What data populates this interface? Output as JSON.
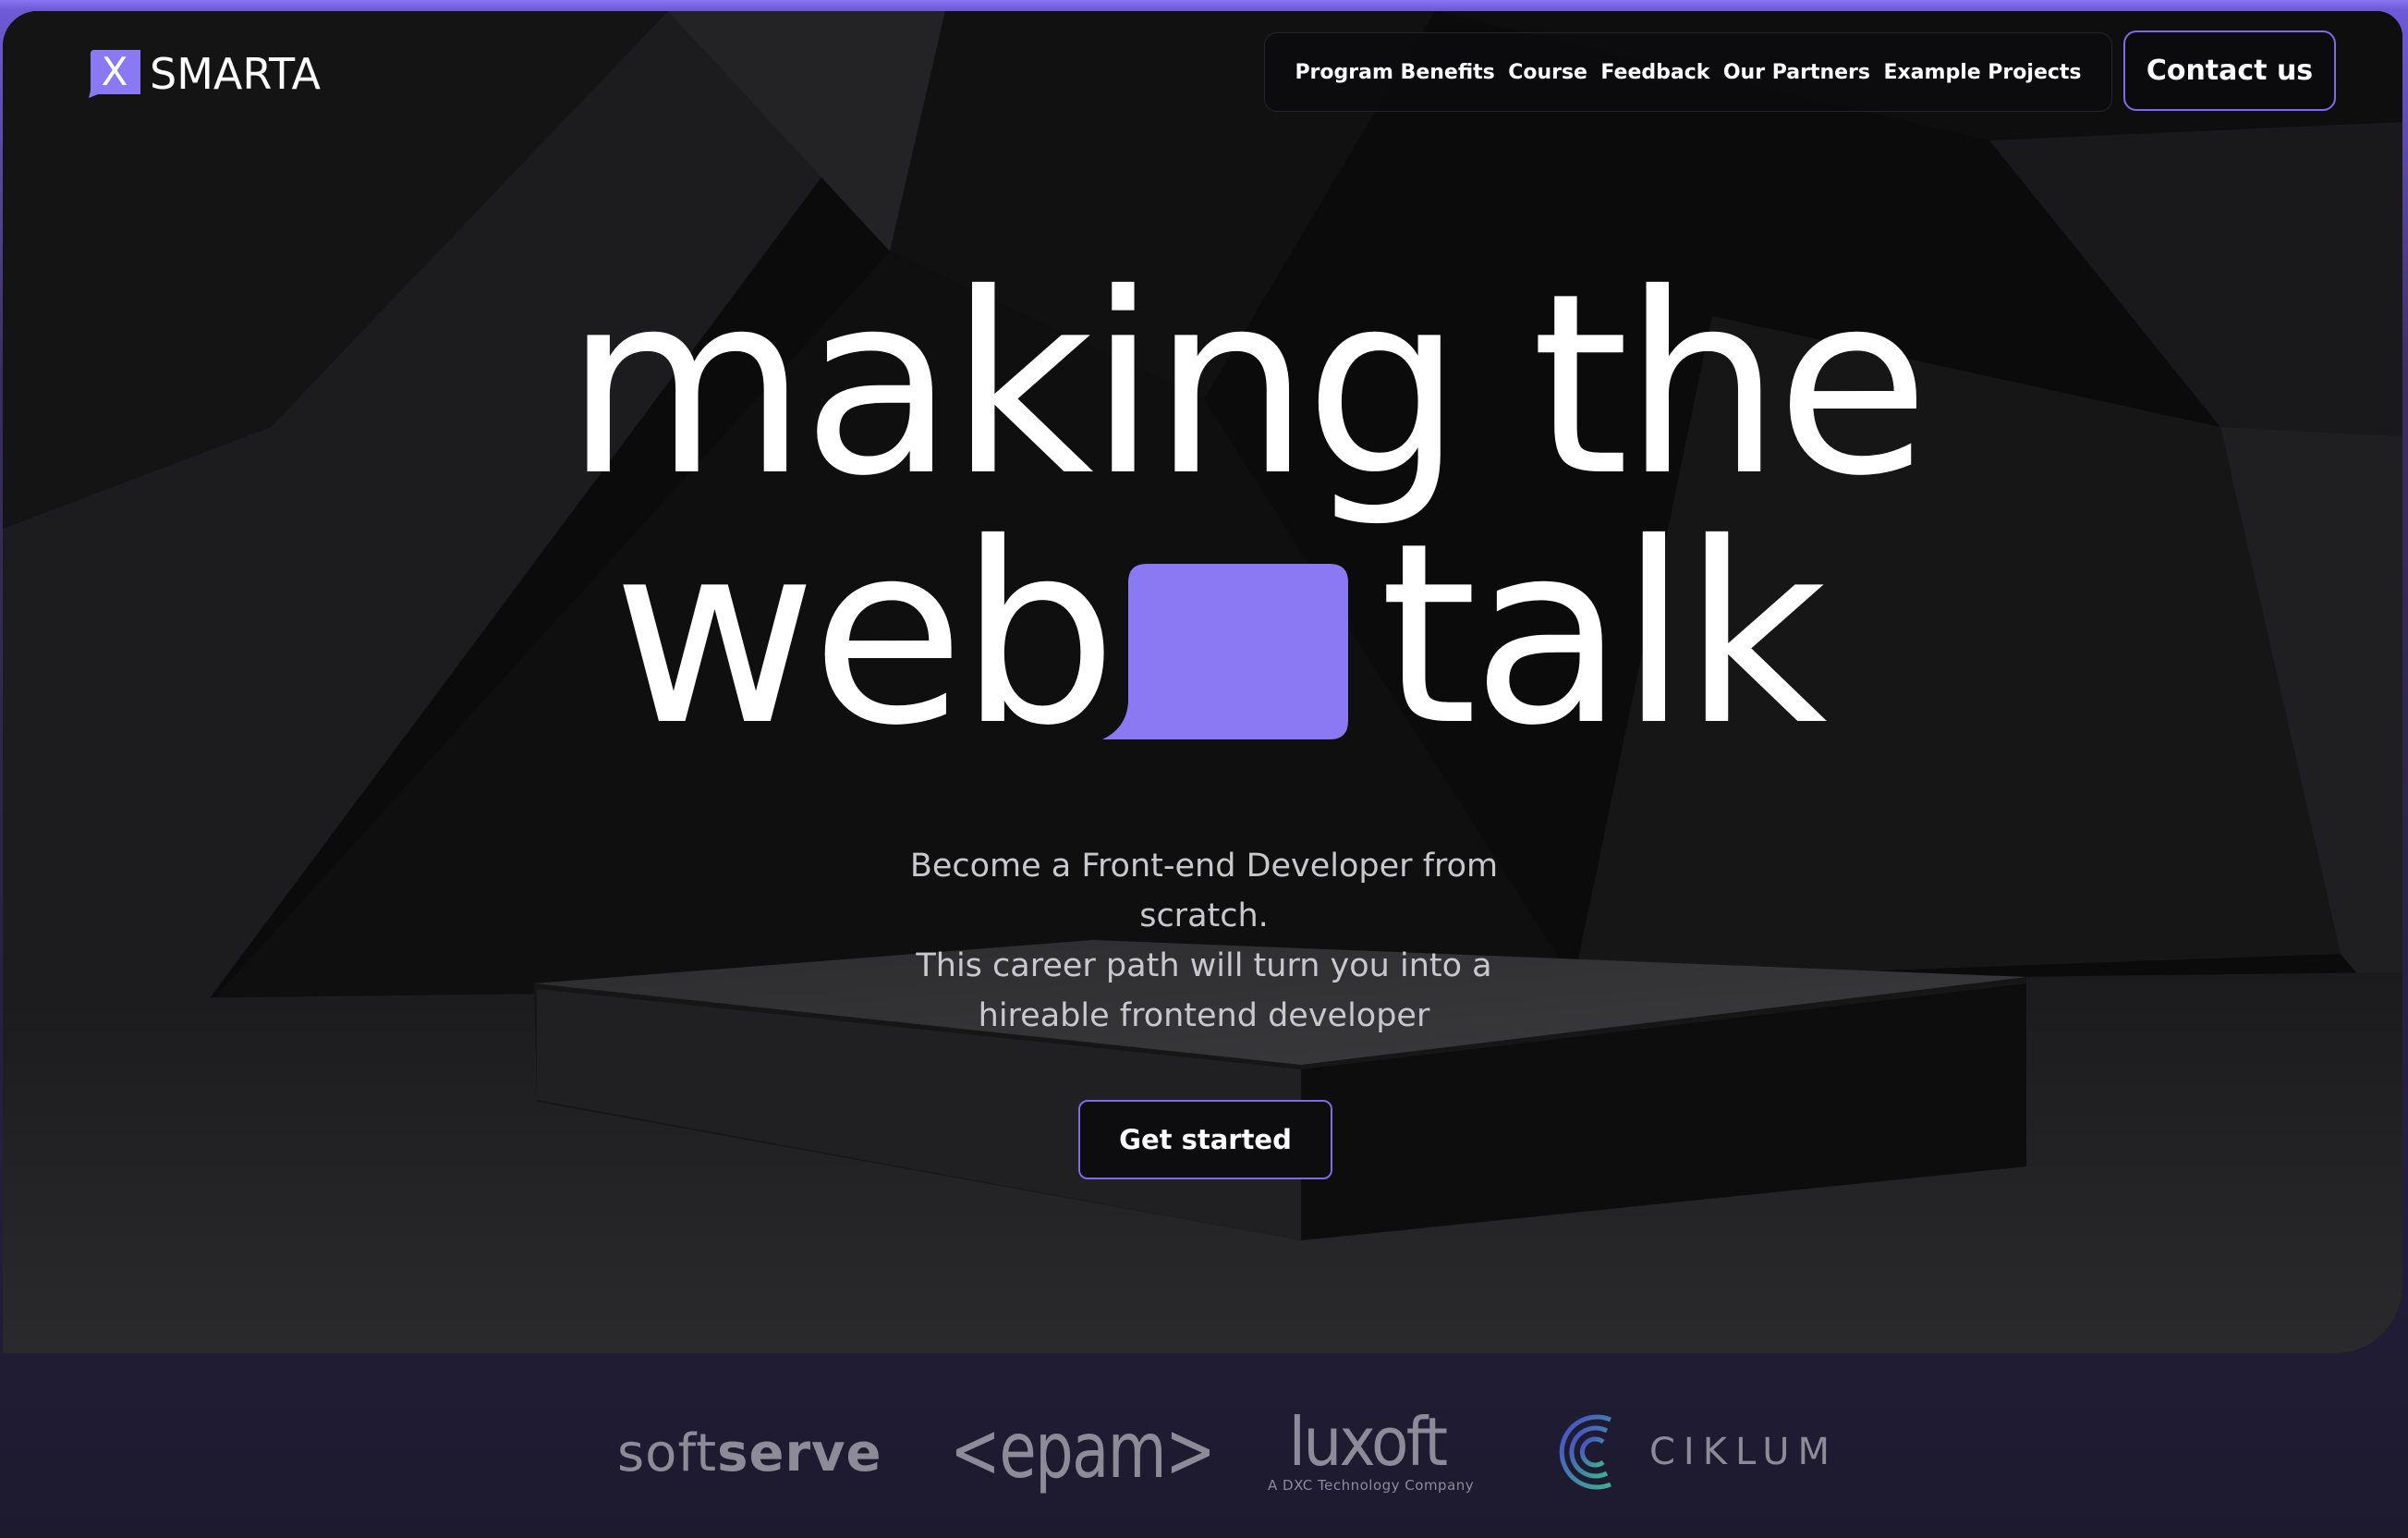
{
  "brand": {
    "logo_letter": "X",
    "name": "SMARTA",
    "accent": "#8b78f3"
  },
  "nav": {
    "items": [
      {
        "label": "Program Benefits"
      },
      {
        "label": "Course"
      },
      {
        "label": "Feedback"
      },
      {
        "label": "Our Partners"
      },
      {
        "label": "Example Projects"
      }
    ],
    "contact_label": "Contact us"
  },
  "hero": {
    "headline_line1": "making the",
    "headline_line2_start": "web",
    "headline_line2_end": "talk",
    "subtitle_lines": [
      "Become a Front-end Developer from",
      "scratch.",
      "This career path will turn you into a",
      "hireable frontend developer"
    ],
    "cta_label": "Get started"
  },
  "partners": {
    "softserve_light": "soft",
    "softserve_bold": "serve",
    "epam": "<epam>",
    "luxoft": "luxoft",
    "luxoft_tagline": "A DXC Technology Company",
    "ciklum": "CIKLUM"
  },
  "colors": {
    "background_dark": "#0c0c0e",
    "frame_purple": "#8a76f2",
    "button_border": "#7e6be8",
    "partner_gray": "#8d8b98"
  }
}
